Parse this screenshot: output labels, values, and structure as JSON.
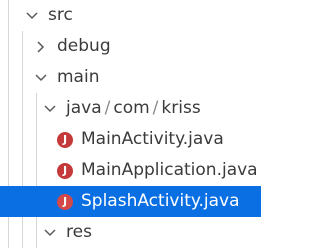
{
  "tree": {
    "src_label": "src",
    "debug_label": "debug",
    "main_label": "main",
    "path": {
      "java": "java",
      "com": "com",
      "kriss": "kriss",
      "separator": "/"
    },
    "files": [
      {
        "label": "MainActivity.java",
        "icon": "java-file-icon"
      },
      {
        "label": "MainApplication.java",
        "icon": "java-file-icon"
      },
      {
        "label": "SplashActivity.java",
        "icon": "java-file-icon",
        "selected": true
      }
    ],
    "res_label": "res",
    "java_icon_glyph": "J"
  },
  "colors": {
    "selection": "#0a6fe3",
    "java_icon": "#c43a3a",
    "guide_line": "#d6d6d6"
  }
}
